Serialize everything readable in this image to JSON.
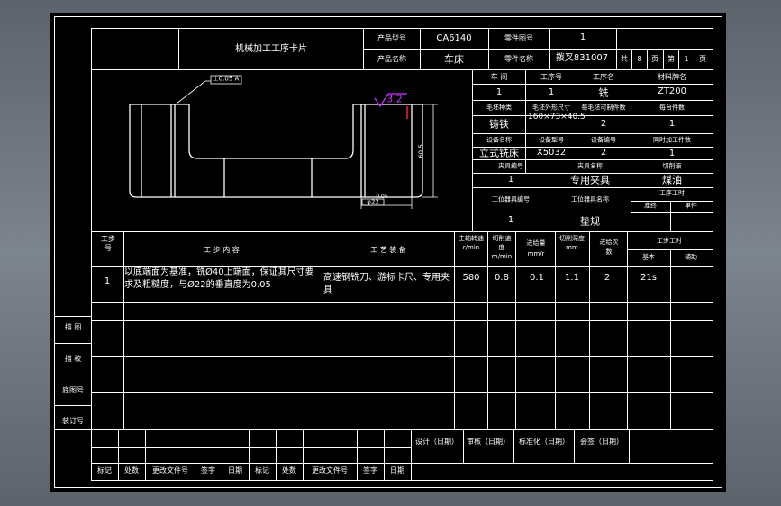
{
  "header": {
    "title": "机械加工工序卡片",
    "product_model_label": "产品型号",
    "product_model": "CA6140",
    "part_no_label": "零件图号",
    "part_no": "1",
    "product_name_label": "产品名称",
    "product_name": "车床",
    "part_name_label": "零件名称",
    "part_name": "拨叉831007",
    "total_label": "共",
    "total_pages": "8",
    "page_label": "页",
    "sheet_label": "第",
    "sheet_no": "1",
    "sheet_page_label": "页"
  },
  "info": {
    "workshop_label": "车  间",
    "op_no_label": "工序号",
    "op_name_label": "工序名",
    "material_label": "材料牌名",
    "workshop": "1",
    "op_no": "1",
    "op_name": "铣",
    "material": "ZT200",
    "blank_type_label": "毛坯种类",
    "blank_size_label": "毛坯外形尺寸",
    "blank_count_label": "每毛坯可制件数",
    "per_unit_label": "每台件数",
    "blank_type": "铸铁",
    "blank_size": "160×73×40.5",
    "blank_count": "2",
    "per_unit": "1",
    "equip_name_label": "设备名称",
    "equip_model_label": "设备型号",
    "equip_no_label": "设备编号",
    "concurrent_label": "同时加工件数",
    "equip_name": "立式铣床",
    "equip_model": "X5032",
    "equip_no": "2",
    "concurrent": "1",
    "fixture_no_label": "夹具编号",
    "fixture_name_label": "夹具名称",
    "coolant_label": "切削液",
    "fixture_no": "1",
    "fixture_name": "专用夹具",
    "coolant": "煤油",
    "station_no_label": "工位器具编号",
    "station_name_label": "工位器具名称",
    "op_hours_label": "工序工时",
    "prep_label": "准终",
    "unit_label": "单件",
    "station_no": "1",
    "station_name": "垫规"
  },
  "drawing": {
    "roughness": "3.2",
    "dim_vertical": "60.5",
    "dim_dia": "φ22",
    "dim_small": "0.05",
    "datum_box": "⊥0.05 A"
  },
  "steps_header": {
    "step_no": "工步号",
    "content": "工  步  内  容",
    "equipment": "工  艺  装  备",
    "spindle": "主轴转速r/min",
    "cut_speed": "切削速度m/min",
    "feed": "进给量mm/r",
    "depth": "切削深度mm",
    "passes": "进给次数",
    "hours": "工步工时",
    "machine": "基本",
    "aux": "辅助"
  },
  "steps": [
    {
      "no": "1",
      "content": "以底端面为基准，铣Ø40上端面，保证其尺寸要求及粗糙度，与Ø22的垂直度为0.05",
      "equipment": "高速钢铣刀、游标卡尺、专用夹具",
      "spindle": "580",
      "speed": "0.8",
      "feed": "0.1",
      "depth": "1.1",
      "passes": "2",
      "time": "21s"
    }
  ],
  "left_labels": [
    "描  图",
    "描  校",
    "底图号",
    "装订号"
  ],
  "sign": {
    "design": "设计（日期）",
    "review": "审核（日期）",
    "standard": "标准化（日期）",
    "approve": "会签（日期）",
    "cols": [
      "标记",
      "处数",
      "更改文件号",
      "签字",
      "日期",
      "标记",
      "处数",
      "更改文件号",
      "签字",
      "日期"
    ]
  }
}
